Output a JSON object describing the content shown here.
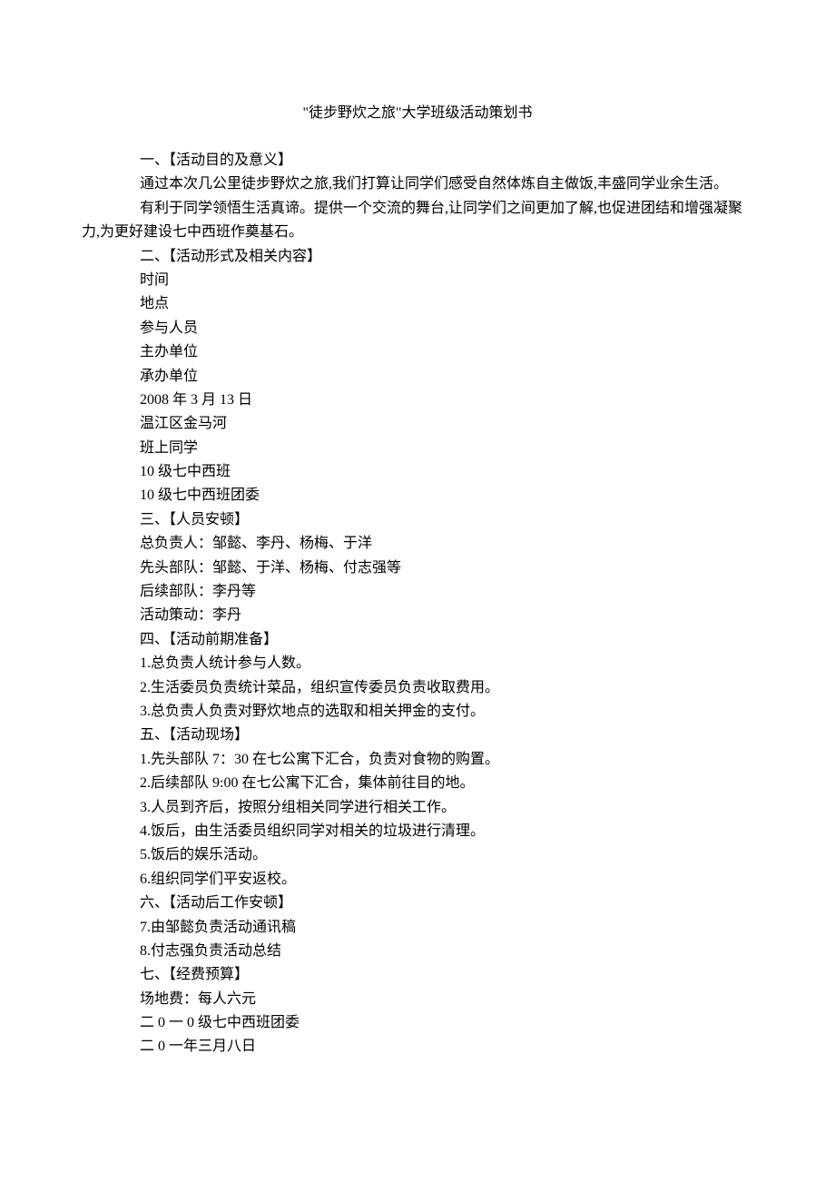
{
  "title": "\"徒步野炊之旅\"大学班级活动策划书",
  "section1": {
    "heading": "一、【活动目的及意义】",
    "para1": "通过本次几公里徒步野炊之旅,我们打算让同学们感受自然体炼自主做饭,丰盛同学业余生活。",
    "para2": "有利于同学领悟生活真谛。提供一个交流的舞台,让同学们之间更加了解,也促进团结和增强凝聚力,为更好建设七中西班作奠基石。"
  },
  "section2": {
    "heading": "二、【活动形式及相关内容】",
    "labels": [
      "时间",
      "地点",
      "参与人员",
      "主办单位",
      "承办单位"
    ],
    "values": [
      "2008 年 3 月 13 日",
      "温江区金马河",
      "班上同学",
      "10 级七中西班",
      "10 级七中西班团委"
    ]
  },
  "section3": {
    "heading": "三、【人员安顿】",
    "items": [
      "总负责人：邹懿、李丹、杨梅、于洋",
      "先头部队：邹懿、于洋、杨梅、付志强等",
      "后续部队：李丹等",
      "活动策动：李丹"
    ]
  },
  "section4": {
    "heading": "四、【活动前期准备】",
    "items": [
      "1.总负责人统计参与人数。",
      "2.生活委员负责统计菜品，组织宣传委员负责收取费用。",
      "3.总负责人负责对野炊地点的选取和相关押金的支付。"
    ]
  },
  "section5": {
    "heading": "五、【活动现场】",
    "items": [
      "1.先头部队 7：30 在七公寓下汇合，负责对食物的购置。",
      "2.后续部队 9:00 在七公寓下汇合，集体前往目的地。",
      "3.人员到齐后，按照分组相关同学进行相关工作。",
      "4.饭后，由生活委员组织同学对相关的垃圾进行清理。",
      "5.饭后的娱乐活动。",
      "6.组织同学们平安返校。"
    ]
  },
  "section6": {
    "heading": "六、【活动后工作安顿】",
    "items": [
      "7.由邹懿负责活动通讯稿",
      "8.付志强负责活动总结"
    ]
  },
  "section7": {
    "heading": "七、【经费预算】",
    "items": [
      "场地费：每人六元",
      "二 0 一 0 级七中西班团委",
      "二 0 一年三月八日"
    ]
  }
}
